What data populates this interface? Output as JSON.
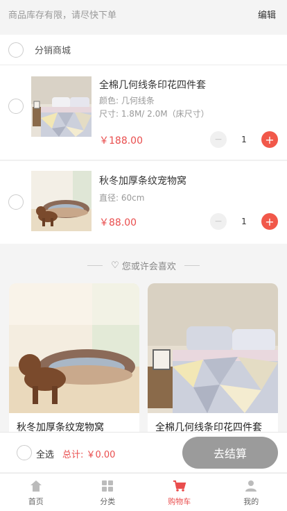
{
  "notice": {
    "text": "商品库存有限，请尽快下单",
    "edit_label": "编辑"
  },
  "shop": {
    "name": "分销商城"
  },
  "cart_items": [
    {
      "title": "全棉几何线条印花四件套",
      "spec": "颜色: 几何线条",
      "spec2": "尺寸: 1.8M/ 2.0M（床尺寸）",
      "price": "￥188.00",
      "quantity": "1",
      "image_icon": "bedding-image"
    },
    {
      "title": "秋冬加厚条纹宠物窝",
      "spec": "直径: 60cm",
      "price": "￥88.00",
      "quantity": "1",
      "image_icon": "pet-bed-image"
    }
  ],
  "recommend": {
    "title": "您或许会喜欢",
    "items": [
      {
        "name": "秋冬加厚条纹宠物窝",
        "image_icon": "pet-bed-image"
      },
      {
        "name": "全棉几何线条印花四件套",
        "image_icon": "bedding-image"
      }
    ]
  },
  "checkout": {
    "select_all_label": "全选",
    "total_label": "总计: ￥0.00",
    "settle_label": "去结算"
  },
  "tabbar": {
    "items": [
      {
        "label": "首页",
        "icon": "home-icon",
        "active": false
      },
      {
        "label": "分类",
        "icon": "category-icon",
        "active": false
      },
      {
        "label": "购物车",
        "icon": "cart-icon",
        "active": true
      },
      {
        "label": "我的",
        "icon": "user-icon",
        "active": false
      }
    ]
  },
  "colors": {
    "accent": "#e94d4d",
    "plus_button": "#f1584a",
    "settle_disabled": "#9b9b9b"
  }
}
